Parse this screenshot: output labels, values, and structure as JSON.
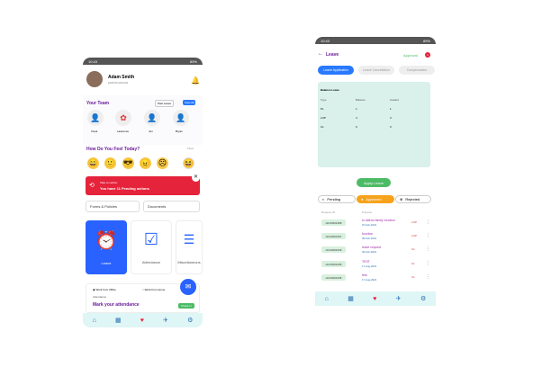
{
  "phone1": {
    "status": {
      "time": "10:43",
      "battery": "89%"
    },
    "user": {
      "name": "Adam Smith",
      "id": "EMP/ROW/0403"
    },
    "team": {
      "title": "Your Team",
      "past_leave": "Past Leave",
      "view_all": "View All",
      "members": [
        {
          "name": "Vivek",
          "sub": "Status"
        },
        {
          "name": "Lawrence",
          "sub": "Last Active: 1 Min Ago"
        },
        {
          "name": "Jon",
          "sub": "Last Active: 1 Min Ago"
        },
        {
          "name": "Bryan",
          "sub": "Last Active: 1 Min Ago"
        }
      ]
    },
    "feel": {
      "title": "How Do You Feel Today?",
      "right": "Tired"
    },
    "alert": {
      "line1": "Take an action",
      "line2": "You have 11 Pending actions"
    },
    "forms_label": "Forms & Policies",
    "documents_label": "Documents",
    "tiles": [
      {
        "label": "Leave"
      },
      {
        "label": "Attendance"
      },
      {
        "label": "Miscellaneous"
      }
    ],
    "attendance": {
      "office": "Work from Office",
      "home": "Work from Home",
      "label": "Attendance",
      "title": "Mark your attendance",
      "check_in": "Check in"
    }
  },
  "phone2": {
    "status": {
      "time": "10:43",
      "battery": "89%"
    },
    "title": "Leave",
    "approval": "Approval",
    "approval_badge": "1",
    "tabs": [
      "Leave Application",
      "Leave Cancellation",
      "Compensation"
    ],
    "balance": {
      "title": "Balance Leave",
      "col_type": "Type",
      "col_balance": "Balance",
      "col_availed": "Availed",
      "rows": [
        {
          "type": "PL",
          "balance": "1",
          "availed": "1"
        },
        {
          "type": "LOP",
          "balance": "4",
          "availed": "3"
        },
        {
          "type": "CL",
          "balance": "0",
          "availed": "0"
        }
      ]
    },
    "apply": "Apply Leave",
    "segments": [
      "Pending",
      "Approved",
      "Rejected"
    ],
    "list_header": {
      "req": "Request ID",
      "purpose": "Purpose"
    },
    "requests": [
      {
        "id": "LR-ID001368",
        "purpose": "to attend family function",
        "date": "07-Feb-2023",
        "type": "LOP"
      },
      {
        "id": "LR-ID001367",
        "purpose": "function",
        "date": "09-Feb-2023",
        "type": "LOP"
      },
      {
        "id": "LR-ID001339",
        "purpose": "leave request",
        "date": "09-Feb-2023",
        "type": "CL"
      },
      {
        "id": "LR-ID001336",
        "purpose": "TEST",
        "date": "17-Aug-2022",
        "type": "CL"
      },
      {
        "id": "LR-ID001335",
        "purpose": "test",
        "date": "17-Aug-2022",
        "type": "CL"
      }
    ]
  },
  "colors": {
    "accent": "#6a1b9a",
    "alert": "#e5233b",
    "blue": "#2979ff",
    "green": "#4cbb65"
  }
}
